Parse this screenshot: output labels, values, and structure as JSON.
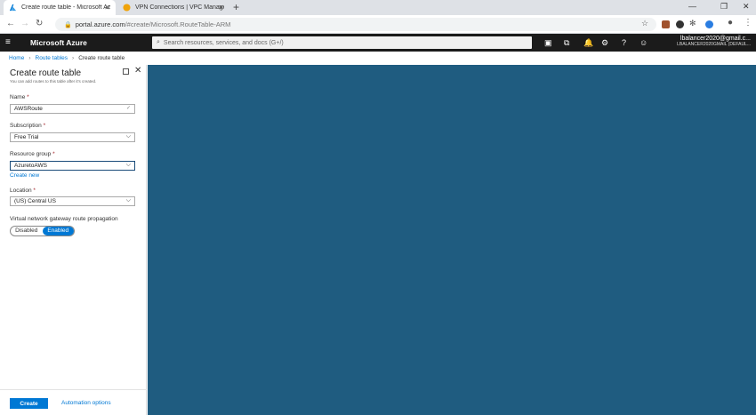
{
  "browser": {
    "tabs": [
      {
        "title": "Create route table - Microsoft Az",
        "active": true
      },
      {
        "title": "VPN Connections | VPC Manage",
        "active": false
      }
    ],
    "new_tab": "+",
    "url_host": "portal.azure.com",
    "url_path": "/#create/Microsoft.RouteTable-ARM"
  },
  "azure": {
    "brand": "Microsoft Azure",
    "search_placeholder": "Search resources, services, and docs (G+/)",
    "account_email": "lbalancer2020@gmail.c...",
    "account_directory": "LBALANCER2020GMAIL (DEFAUL..."
  },
  "breadcrumb": {
    "home": "Home",
    "route_tables": "Route tables",
    "current": "Create route table"
  },
  "blade": {
    "title": "Create route table",
    "subtitle": "You can add routes to this table after it's created.",
    "name_label": "Name",
    "name_value": "AWSRoute",
    "subscription_label": "Subscription",
    "subscription_value": "Free Trial",
    "resource_group_label": "Resource group",
    "resource_group_value": "AzuretoAWS",
    "create_new": "Create new",
    "location_label": "Location",
    "location_value": "(US) Central US",
    "propagation_label": "Virtual network gateway route propagation",
    "toggle_off": "Disabled",
    "toggle_on": "Enabled",
    "required_mark": "*",
    "create_button": "Create",
    "automation_link": "Automation options"
  },
  "colors": {
    "accent": "#0078d4",
    "header": "#1b1b1b",
    "background": "#1f5c80"
  }
}
